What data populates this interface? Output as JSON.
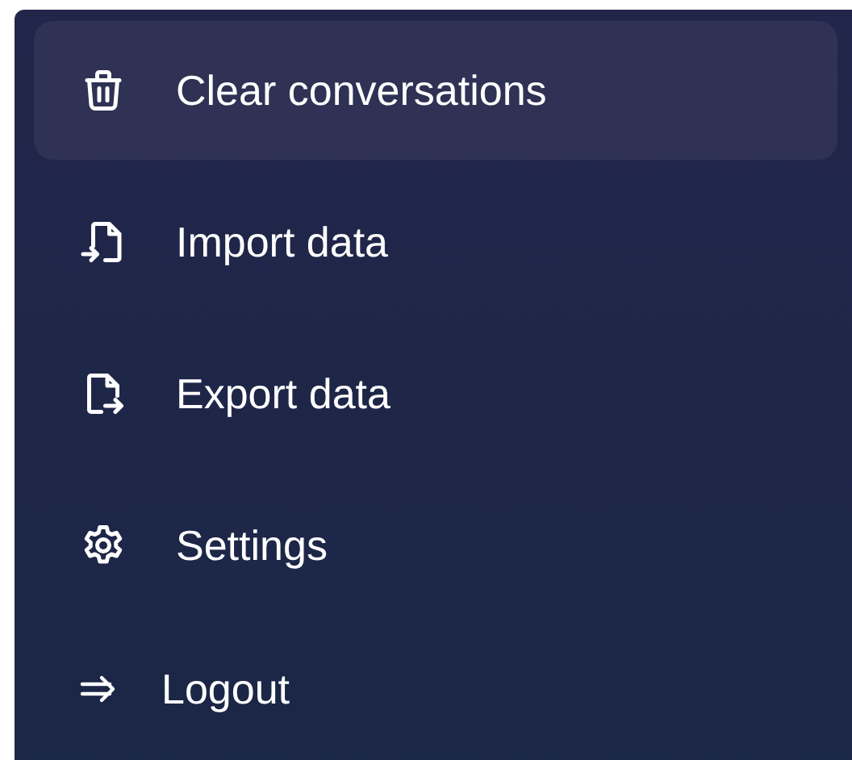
{
  "menu": {
    "items": [
      {
        "kind": "delete",
        "label": "Clear conversations",
        "selected": true
      },
      {
        "kind": "import",
        "label": "Import data",
        "selected": false
      },
      {
        "kind": "export",
        "label": "Export data",
        "selected": false
      },
      {
        "kind": "settings",
        "label": "Settings",
        "selected": false
      },
      {
        "kind": "logout",
        "label": "Logout",
        "selected": false
      }
    ]
  }
}
